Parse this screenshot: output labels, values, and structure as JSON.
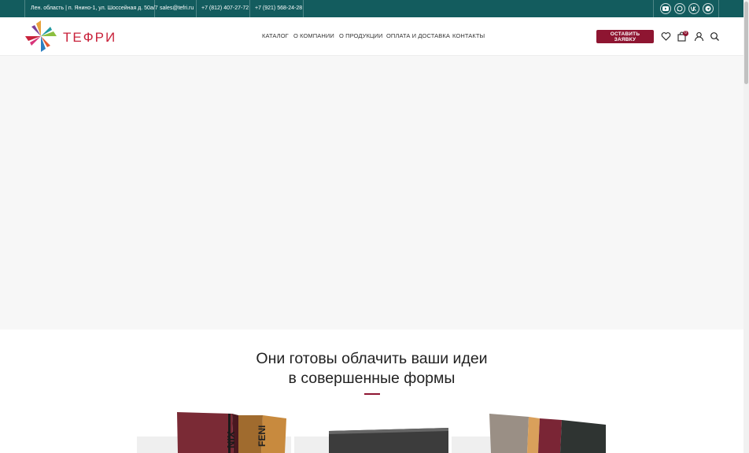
{
  "topbar": {
    "address": "Лен. область | п. Янино-1, ул. Шоссейная д. 50а/7",
    "email": "sales@tefri.ru",
    "phone1": "+7 (812) 407-27-72",
    "phone2": "+7 (921) 568-24-28",
    "social": [
      "youtube-icon",
      "whatsapp-icon",
      "vk-icon",
      "telegram-icon"
    ]
  },
  "header": {
    "logo_text": "ТЕФРИ",
    "nav": [
      "КАТАЛОГ",
      "О КОМПАНИИ",
      "О ПРОДУКЦИИ",
      "ОПЛАТА И ДОСТАВКА",
      "КОНТАКТЫ"
    ],
    "cta_label": "ОСТАВИТЬ ЗАЯВКУ",
    "cart_count": "0"
  },
  "section": {
    "title_line1": "Они готовы облачить ваши идеи",
    "title_line2": "в совершенные формы"
  },
  "colors": {
    "topbar": "#135c5e",
    "accent": "#8e1531",
    "logo": "#c8223b"
  }
}
